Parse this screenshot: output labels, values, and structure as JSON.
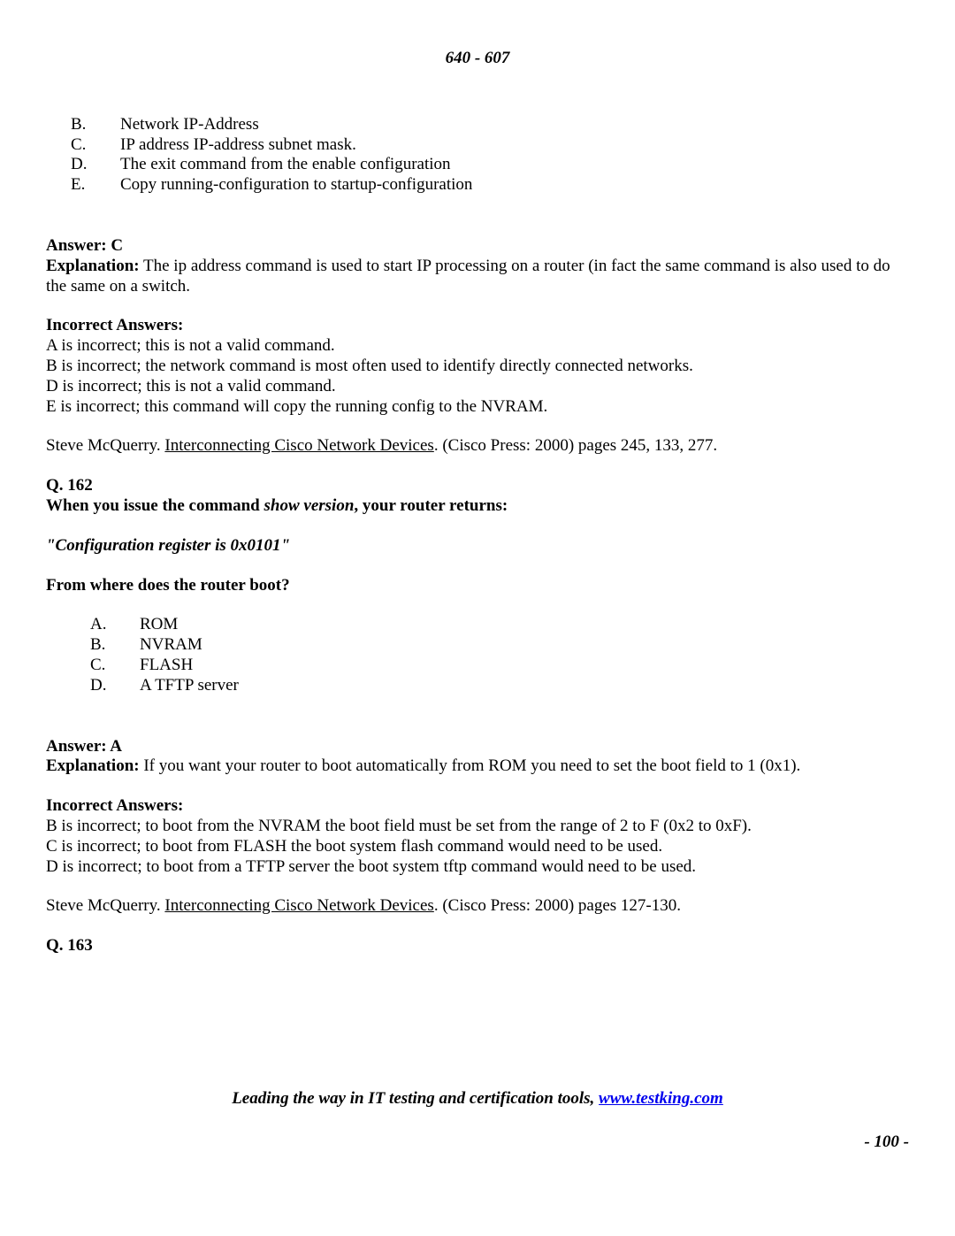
{
  "header": "640 - 607",
  "q161": {
    "options": [
      {
        "letter": "B.",
        "text": "Network IP-Address"
      },
      {
        "letter": "C.",
        "text": "IP address IP-address subnet mask."
      },
      {
        "letter": "D.",
        "text": "The exit command from the enable configuration"
      },
      {
        "letter": "E.",
        "text": "Copy running-configuration to startup-configuration"
      }
    ],
    "answer_label": "Answer: C",
    "explanation_label": "Explanation:",
    "explanation_text": " The ip address command is used to start IP processing on a router (in fact the same command is also used to do the same on a switch.",
    "incorrect_label": "Incorrect Answers:",
    "incorrect": [
      "A is incorrect; this is not a valid command.",
      "B is incorrect; the network command is most often used to identify directly connected networks.",
      "D is incorrect; this is not a valid command.",
      "E is incorrect; this command will copy the running config to the NVRAM."
    ],
    "ref_author": "Steve McQuerry.  ",
    "ref_title": "Interconnecting Cisco Network Devices",
    "ref_suffix": ". (Cisco Press: 2000) pages 245, 133, 277."
  },
  "q162": {
    "heading": "Q. 162",
    "prompt_prefix": "When you issue the command ",
    "prompt_italic": "show version",
    "prompt_suffix": ", your router returns:",
    "register": "\"Configuration register is 0x0101\"",
    "boot_question": "From where does the router boot?",
    "options": [
      {
        "letter": "A.",
        "text": "ROM"
      },
      {
        "letter": "B.",
        "text": "NVRAM"
      },
      {
        "letter": "C.",
        "text": "FLASH"
      },
      {
        "letter": "D.",
        "text": "A TFTP server"
      }
    ],
    "answer_label": "Answer:  A",
    "explanation_label": "Explanation:",
    "explanation_text": " If you want your router to boot automatically from ROM you need to set the boot field to 1 (0x1).",
    "incorrect_label": "Incorrect Answers:",
    "incorrect": [
      "B is incorrect; to boot from the NVRAM the boot field must be set from the range of 2 to F (0x2 to 0xF).",
      "C is incorrect; to boot from FLASH the boot system flash command would need to be used.",
      "D is incorrect; to boot from a TFTP server the boot system tftp command would need to be used."
    ],
    "ref_author": "Steve McQuerry.  ",
    "ref_title": "Interconnecting Cisco Network Devices",
    "ref_suffix": ". (Cisco Press: 2000) pages 127-130."
  },
  "q163": {
    "heading": "Q. 163"
  },
  "footer": {
    "tagline_prefix": "Leading the way in IT testing and certification tools, ",
    "link_text": "www.testking.com",
    "page_number": "- 100 -"
  }
}
